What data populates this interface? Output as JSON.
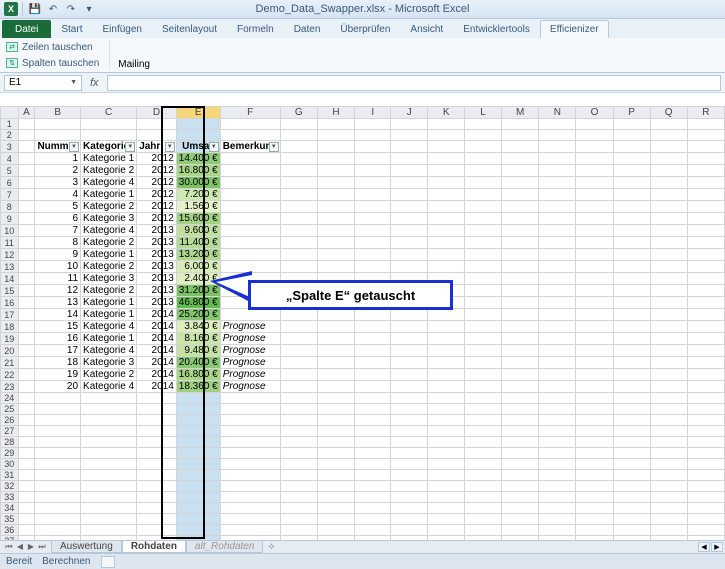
{
  "title": "Demo_Data_Swapper.xlsx - Microsoft Excel",
  "qat": {
    "save": "💾",
    "undo": "↶",
    "redo": "↷"
  },
  "tabs": {
    "file": "Datei",
    "list": [
      "Start",
      "Einfügen",
      "Seitenlayout",
      "Formeln",
      "Daten",
      "Überprüfen",
      "Ansicht",
      "Entwicklertools",
      "Efficienizer"
    ],
    "active": "Efficienizer"
  },
  "ribbon": {
    "btn1": "Zeilen tauschen",
    "btn2": "Spalten tauschen",
    "group_label": "Mailing"
  },
  "namebox": "E1",
  "fx": "fx",
  "columns": [
    "A",
    "B",
    "C",
    "D",
    "E",
    "F",
    "G",
    "H",
    "I",
    "J",
    "K",
    "L",
    "M",
    "N",
    "O",
    "P",
    "Q",
    "R"
  ],
  "headers": {
    "nummer": "Nummer",
    "kategorie": "Kategorie",
    "jahr": "Jahr",
    "umsatz": "Umsatz",
    "bemerkung": "Bemerkung"
  },
  "rows": [
    {
      "n": "1",
      "k": "Kategorie 1",
      "j": "2012",
      "u": "14.400 €",
      "b": "",
      "g": "g1"
    },
    {
      "n": "2",
      "k": "Kategorie 2",
      "j": "2012",
      "u": "16.800 €",
      "b": "",
      "g": "g2"
    },
    {
      "n": "3",
      "k": "Kategorie 4",
      "j": "2012",
      "u": "30.000 €",
      "b": "",
      "g": "g3"
    },
    {
      "n": "4",
      "k": "Kategorie 1",
      "j": "2012",
      "u": "7.200 €",
      "b": "",
      "g": "g4"
    },
    {
      "n": "5",
      "k": "Kategorie 2",
      "j": "2012",
      "u": "1.560 €",
      "b": "",
      "g": "g5"
    },
    {
      "n": "6",
      "k": "Kategorie 3",
      "j": "2012",
      "u": "15.600 €",
      "b": "",
      "g": "g6"
    },
    {
      "n": "7",
      "k": "Kategorie 4",
      "j": "2013",
      "u": "9.600 €",
      "b": "",
      "g": "g7"
    },
    {
      "n": "8",
      "k": "Kategorie 2",
      "j": "2013",
      "u": "11.400 €",
      "b": "",
      "g": "g8"
    },
    {
      "n": "9",
      "k": "Kategorie 1",
      "j": "2013",
      "u": "13.200 €",
      "b": "",
      "g": "g9"
    },
    {
      "n": "10",
      "k": "Kategorie 2",
      "j": "2013",
      "u": "6.000 €",
      "b": "",
      "g": "g10"
    },
    {
      "n": "11",
      "k": "Kategorie 3",
      "j": "2013",
      "u": "2.400 €",
      "b": "",
      "g": "g11"
    },
    {
      "n": "12",
      "k": "Kategorie 2",
      "j": "2013",
      "u": "31.200 €",
      "b": "",
      "g": "g12"
    },
    {
      "n": "13",
      "k": "Kategorie 1",
      "j": "2013",
      "u": "46.800 €",
      "b": "",
      "g": "g13"
    },
    {
      "n": "14",
      "k": "Kategorie 1",
      "j": "2014",
      "u": "25.200 €",
      "b": "",
      "g": "g14"
    },
    {
      "n": "15",
      "k": "Kategorie 4",
      "j": "2014",
      "u": "3.840 €",
      "b": "Prognose",
      "g": "g15"
    },
    {
      "n": "16",
      "k": "Kategorie 1",
      "j": "2014",
      "u": "8.160 €",
      "b": "Prognose",
      "g": "g16"
    },
    {
      "n": "17",
      "k": "Kategorie 4",
      "j": "2014",
      "u": "9.480 €",
      "b": "Prognose",
      "g": "g17"
    },
    {
      "n": "18",
      "k": "Kategorie 3",
      "j": "2014",
      "u": "20.400 €",
      "b": "Prognose",
      "g": "g18"
    },
    {
      "n": "19",
      "k": "Kategorie 2",
      "j": "2014",
      "u": "16.800 €",
      "b": "Prognose",
      "g": "g19"
    },
    {
      "n": "20",
      "k": "Kategorie 4",
      "j": "2014",
      "u": "18.360 €",
      "b": "Prognose",
      "g": "g20"
    }
  ],
  "callout": "„Spalte E“ getauscht",
  "sheets": {
    "s1": "Auswertung",
    "s2": "Rohdaten",
    "s3": "alt_Rohdaten"
  },
  "status": {
    "ready": "Bereit",
    "calc": "Berechnen"
  }
}
